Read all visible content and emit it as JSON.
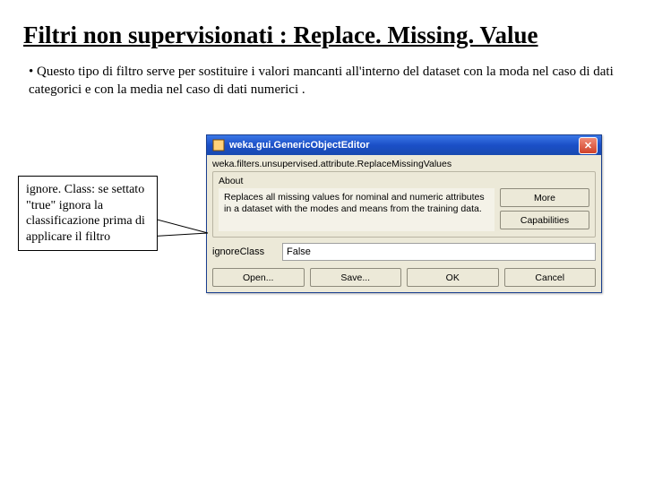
{
  "slide": {
    "title": "Filtri non supervisionati : Replace. Missing. Value",
    "bullet": "• Questo tipo di filtro serve per sostituire i valori mancanti all'interno del dataset con la moda nel caso di dati categorici e con la media nel caso di dati numerici ."
  },
  "callout": {
    "text": "ignore. Class: se settato \"true\" ignora la classificazione prima di applicare il filtro"
  },
  "dialog": {
    "title": "weka.gui.GenericObjectEditor",
    "classLine": "weka.filters.unsupervised.attribute.ReplaceMissingValues",
    "about": {
      "label": "About",
      "description": "Replaces all missing values for nominal and numeric attributes in a dataset with the modes and means from the training data.",
      "moreBtn": "More",
      "capabilitiesBtn": "Capabilities"
    },
    "field": {
      "label": "ignoreClass",
      "value": "False"
    },
    "buttons": {
      "open": "Open...",
      "save": "Save...",
      "ok": "OK",
      "cancel": "Cancel"
    },
    "closeGlyph": "✕"
  }
}
